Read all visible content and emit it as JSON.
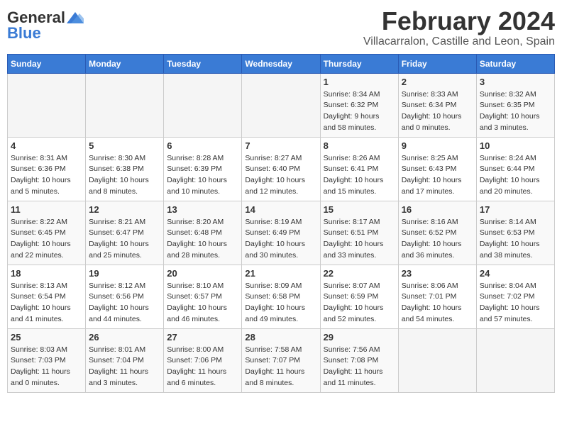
{
  "header": {
    "logo_general": "General",
    "logo_blue": "Blue",
    "month_year": "February 2024",
    "location": "Villacarralon, Castille and Leon, Spain"
  },
  "days_of_week": [
    "Sunday",
    "Monday",
    "Tuesday",
    "Wednesday",
    "Thursday",
    "Friday",
    "Saturday"
  ],
  "weeks": [
    [
      {
        "day": "",
        "info": ""
      },
      {
        "day": "",
        "info": ""
      },
      {
        "day": "",
        "info": ""
      },
      {
        "day": "",
        "info": ""
      },
      {
        "day": "1",
        "info": "Sunrise: 8:34 AM\nSunset: 6:32 PM\nDaylight: 9 hours\nand 58 minutes."
      },
      {
        "day": "2",
        "info": "Sunrise: 8:33 AM\nSunset: 6:34 PM\nDaylight: 10 hours\nand 0 minutes."
      },
      {
        "day": "3",
        "info": "Sunrise: 8:32 AM\nSunset: 6:35 PM\nDaylight: 10 hours\nand 3 minutes."
      }
    ],
    [
      {
        "day": "4",
        "info": "Sunrise: 8:31 AM\nSunset: 6:36 PM\nDaylight: 10 hours\nand 5 minutes."
      },
      {
        "day": "5",
        "info": "Sunrise: 8:30 AM\nSunset: 6:38 PM\nDaylight: 10 hours\nand 8 minutes."
      },
      {
        "day": "6",
        "info": "Sunrise: 8:28 AM\nSunset: 6:39 PM\nDaylight: 10 hours\nand 10 minutes."
      },
      {
        "day": "7",
        "info": "Sunrise: 8:27 AM\nSunset: 6:40 PM\nDaylight: 10 hours\nand 12 minutes."
      },
      {
        "day": "8",
        "info": "Sunrise: 8:26 AM\nSunset: 6:41 PM\nDaylight: 10 hours\nand 15 minutes."
      },
      {
        "day": "9",
        "info": "Sunrise: 8:25 AM\nSunset: 6:43 PM\nDaylight: 10 hours\nand 17 minutes."
      },
      {
        "day": "10",
        "info": "Sunrise: 8:24 AM\nSunset: 6:44 PM\nDaylight: 10 hours\nand 20 minutes."
      }
    ],
    [
      {
        "day": "11",
        "info": "Sunrise: 8:22 AM\nSunset: 6:45 PM\nDaylight: 10 hours\nand 22 minutes."
      },
      {
        "day": "12",
        "info": "Sunrise: 8:21 AM\nSunset: 6:47 PM\nDaylight: 10 hours\nand 25 minutes."
      },
      {
        "day": "13",
        "info": "Sunrise: 8:20 AM\nSunset: 6:48 PM\nDaylight: 10 hours\nand 28 minutes."
      },
      {
        "day": "14",
        "info": "Sunrise: 8:19 AM\nSunset: 6:49 PM\nDaylight: 10 hours\nand 30 minutes."
      },
      {
        "day": "15",
        "info": "Sunrise: 8:17 AM\nSunset: 6:51 PM\nDaylight: 10 hours\nand 33 minutes."
      },
      {
        "day": "16",
        "info": "Sunrise: 8:16 AM\nSunset: 6:52 PM\nDaylight: 10 hours\nand 36 minutes."
      },
      {
        "day": "17",
        "info": "Sunrise: 8:14 AM\nSunset: 6:53 PM\nDaylight: 10 hours\nand 38 minutes."
      }
    ],
    [
      {
        "day": "18",
        "info": "Sunrise: 8:13 AM\nSunset: 6:54 PM\nDaylight: 10 hours\nand 41 minutes."
      },
      {
        "day": "19",
        "info": "Sunrise: 8:12 AM\nSunset: 6:56 PM\nDaylight: 10 hours\nand 44 minutes."
      },
      {
        "day": "20",
        "info": "Sunrise: 8:10 AM\nSunset: 6:57 PM\nDaylight: 10 hours\nand 46 minutes."
      },
      {
        "day": "21",
        "info": "Sunrise: 8:09 AM\nSunset: 6:58 PM\nDaylight: 10 hours\nand 49 minutes."
      },
      {
        "day": "22",
        "info": "Sunrise: 8:07 AM\nSunset: 6:59 PM\nDaylight: 10 hours\nand 52 minutes."
      },
      {
        "day": "23",
        "info": "Sunrise: 8:06 AM\nSunset: 7:01 PM\nDaylight: 10 hours\nand 54 minutes."
      },
      {
        "day": "24",
        "info": "Sunrise: 8:04 AM\nSunset: 7:02 PM\nDaylight: 10 hours\nand 57 minutes."
      }
    ],
    [
      {
        "day": "25",
        "info": "Sunrise: 8:03 AM\nSunset: 7:03 PM\nDaylight: 11 hours\nand 0 minutes."
      },
      {
        "day": "26",
        "info": "Sunrise: 8:01 AM\nSunset: 7:04 PM\nDaylight: 11 hours\nand 3 minutes."
      },
      {
        "day": "27",
        "info": "Sunrise: 8:00 AM\nSunset: 7:06 PM\nDaylight: 11 hours\nand 6 minutes."
      },
      {
        "day": "28",
        "info": "Sunrise: 7:58 AM\nSunset: 7:07 PM\nDaylight: 11 hours\nand 8 minutes."
      },
      {
        "day": "29",
        "info": "Sunrise: 7:56 AM\nSunset: 7:08 PM\nDaylight: 11 hours\nand 11 minutes."
      },
      {
        "day": "",
        "info": ""
      },
      {
        "day": "",
        "info": ""
      }
    ]
  ]
}
